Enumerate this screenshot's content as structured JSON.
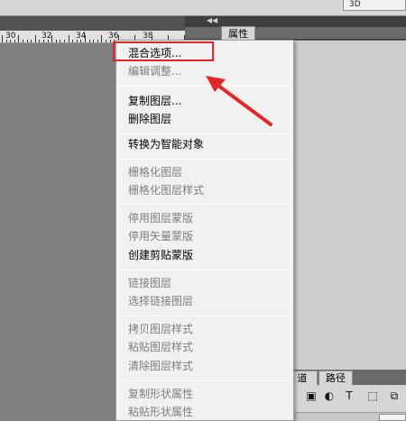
{
  "options_bar": {
    "dropdown_value": "3D"
  },
  "ruler": {
    "ticks": [
      "30",
      "32",
      "34",
      "36",
      "38"
    ]
  },
  "properties_panel": {
    "tab_label": "属性"
  },
  "bottom_panel": {
    "tabs": [
      "道",
      "路径"
    ]
  },
  "context_menu": {
    "items": [
      {
        "label": "混合选项...",
        "enabled": true
      },
      {
        "label": "编辑调整...",
        "enabled": false
      },
      {
        "label": "复制图层...",
        "enabled": true
      },
      {
        "label": "删除图层",
        "enabled": true
      },
      {
        "label": "转换为智能对象",
        "enabled": true
      },
      {
        "label": "栅格化图层",
        "enabled": false
      },
      {
        "label": "栅格化图层样式",
        "enabled": false
      },
      {
        "label": "停用图层蒙版",
        "enabled": false
      },
      {
        "label": "停用矢量蒙版",
        "enabled": false
      },
      {
        "label": "创建剪贴蒙版",
        "enabled": true
      },
      {
        "label": "链接图层",
        "enabled": false
      },
      {
        "label": "选择链接图层",
        "enabled": false
      },
      {
        "label": "拷贝图层样式",
        "enabled": false
      },
      {
        "label": "粘贴图层样式",
        "enabled": false
      },
      {
        "label": "清除图层样式",
        "enabled": false
      },
      {
        "label": "复制形状属性",
        "enabled": false
      },
      {
        "label": "粘贴形状属性",
        "enabled": false
      }
    ]
  },
  "colors": {
    "annotation_red": "#e0282a",
    "menu_background": "#f1f1f1",
    "disabled_text": "#7e7e7e"
  }
}
